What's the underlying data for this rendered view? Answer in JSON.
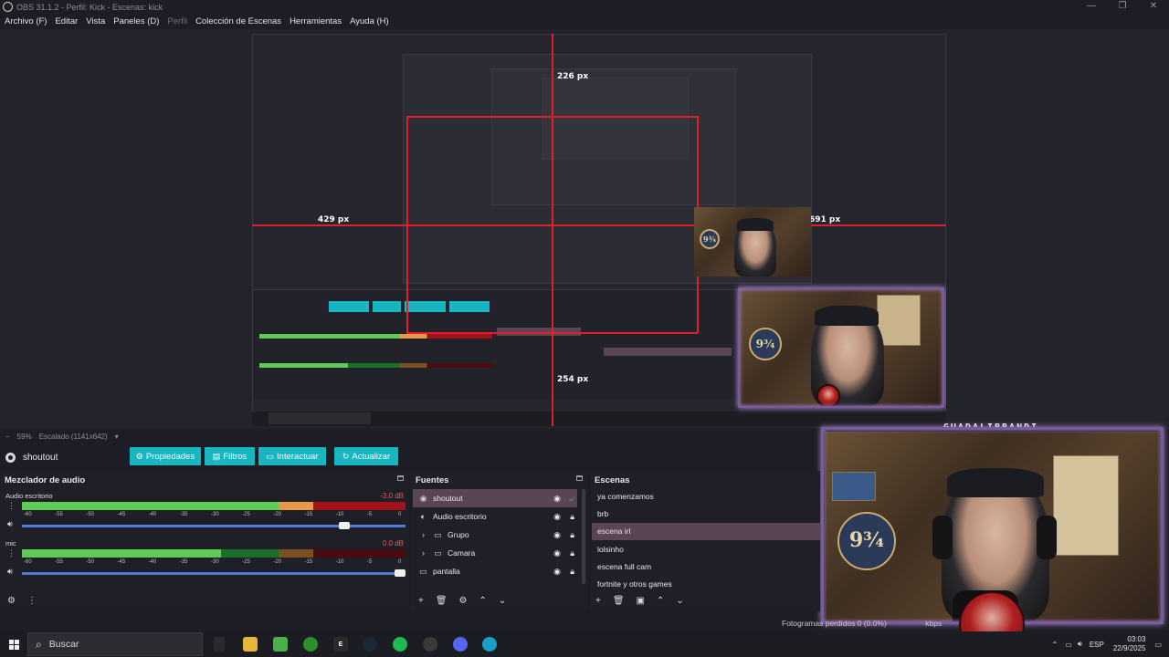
{
  "window": {
    "title": "OBS 31.1.2 - Perfil: Kick - Escenas: kick",
    "controls": [
      "—",
      "❐",
      "✕"
    ]
  },
  "menu": {
    "items": [
      "Archivo (F)",
      "Editar",
      "Vista",
      "Paneles (D)",
      "Perfil",
      "Colección de Escenas",
      "Herramientas",
      "Ayuda (H)"
    ]
  },
  "preview": {
    "guide_top": "226 px",
    "guide_left": "429 px",
    "guide_right": "691 px",
    "guide_bottom": "254 px",
    "camera_name": "GUADALIBRANDI"
  },
  "zoom": {
    "minus": "−",
    "value": "59%",
    "scaling": "Escalado (1141x642)",
    "dropdown": "▾"
  },
  "source_toolbar": {
    "current_source": "shoutout",
    "properties": "Propiedades",
    "filters": "Filtros",
    "interact": "Interactuar",
    "refresh": "Actualizar"
  },
  "mixer": {
    "title": "Mezclador de audio",
    "scale_labels": [
      "-60",
      "-55",
      "-50",
      "-45",
      "-40",
      "-35",
      "-30",
      "-25",
      "-20",
      "-15",
      "-10",
      "-5",
      "0"
    ],
    "tracks": [
      {
        "name": "Audio escritorio",
        "db": "-3.0 dB",
        "level": 0.96,
        "volume": 0.85
      },
      {
        "name": "mic",
        "db": "0.0 dB",
        "level": 0.55,
        "volume": 1.0
      }
    ]
  },
  "sources": {
    "title": "Fuentes",
    "items": [
      {
        "label": "shoutout",
        "icon": "globe",
        "selected": true,
        "locked": false
      },
      {
        "label": "Audio escritorio",
        "icon": "speaker",
        "selected": false,
        "locked": true
      },
      {
        "label": "Grupo",
        "icon": "folder",
        "selected": false,
        "locked": true
      },
      {
        "label": "Camara",
        "icon": "folder",
        "selected": false,
        "locked": true
      },
      {
        "label": "pantalla",
        "icon": "monitor",
        "selected": false,
        "locked": true
      }
    ]
  },
  "scenes": {
    "title": "Escenas",
    "items": [
      {
        "label": "ya comenzamos",
        "selected": false
      },
      {
        "label": "brb",
        "selected": false
      },
      {
        "label": "escena irl",
        "selected": true
      },
      {
        "label": "lolsinho",
        "selected": false
      },
      {
        "label": "escena full cam",
        "selected": false
      },
      {
        "label": "fortnite y otros games",
        "selected": false
      }
    ]
  },
  "status": {
    "frames_text": "Fotogramas perdidos 0 (0.0%)",
    "kbps": "kbps"
  },
  "taskbar": {
    "search_placeholder": "Buscar",
    "language": "ESP",
    "time": "03:03",
    "date": "22/9/2025"
  },
  "colors": {
    "accent": "#19b6c2",
    "guide": "#e21e2a",
    "selection": "#5a4555",
    "frame": "#7a5aa0"
  }
}
